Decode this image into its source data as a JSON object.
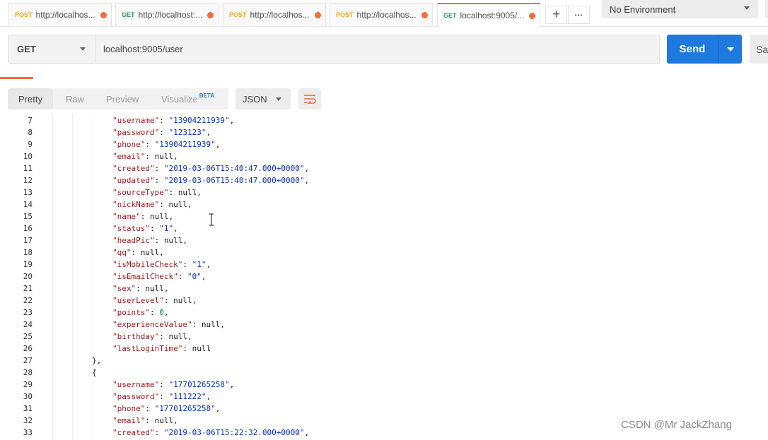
{
  "tabs": [
    {
      "method": "POST",
      "url": "http://localhos..."
    },
    {
      "method": "GET",
      "url": "http://localhost:..."
    },
    {
      "method": "POST",
      "url": "http://localhos..."
    },
    {
      "method": "POST",
      "url": "http://localhos..."
    },
    {
      "method": "GET",
      "url": "localhost:9005/..."
    }
  ],
  "tab_actions": {
    "new_tab": "+",
    "more": "•••"
  },
  "environment": {
    "selected": "No Environment"
  },
  "request": {
    "method": "GET",
    "url": "localhost:9005/user",
    "send_label": "Send",
    "save_label": "Sa"
  },
  "response_toolbar": {
    "views": [
      "Pretty",
      "Raw",
      "Preview",
      "Visualize"
    ],
    "visualize_badge": "BETA",
    "format": "JSON"
  },
  "code_lines": [
    {
      "n": "7",
      "indent": 3,
      "key": "username",
      "val": "\"13904211939\"",
      "type": "s",
      "comma": true
    },
    {
      "n": "8",
      "indent": 3,
      "key": "password",
      "val": "\"123123\"",
      "type": "s",
      "comma": true
    },
    {
      "n": "9",
      "indent": 3,
      "key": "phone",
      "val": "\"13904211939\"",
      "type": "s",
      "comma": true
    },
    {
      "n": "10",
      "indent": 3,
      "key": "email",
      "val": "null",
      "type": "p",
      "comma": true
    },
    {
      "n": "11",
      "indent": 3,
      "key": "created",
      "val": "\"2019-03-06T15:40:47.000+0000\"",
      "type": "s",
      "comma": true
    },
    {
      "n": "12",
      "indent": 3,
      "key": "updated",
      "val": "\"2019-03-06T15:40:47.000+0000\"",
      "type": "s",
      "comma": true
    },
    {
      "n": "13",
      "indent": 3,
      "key": "sourceType",
      "val": "null",
      "type": "p",
      "comma": true
    },
    {
      "n": "14",
      "indent": 3,
      "key": "nickName",
      "val": "null",
      "type": "p",
      "comma": true
    },
    {
      "n": "15",
      "indent": 3,
      "key": "name",
      "val": "null",
      "type": "p",
      "comma": true
    },
    {
      "n": "16",
      "indent": 3,
      "key": "status",
      "val": "\"1\"",
      "type": "s",
      "comma": true
    },
    {
      "n": "17",
      "indent": 3,
      "key": "headPic",
      "val": "null",
      "type": "p",
      "comma": true
    },
    {
      "n": "18",
      "indent": 3,
      "key": "qq",
      "val": "null",
      "type": "p",
      "comma": true
    },
    {
      "n": "19",
      "indent": 3,
      "key": "isMobileCheck",
      "val": "\"1\"",
      "type": "s",
      "comma": true
    },
    {
      "n": "20",
      "indent": 3,
      "key": "isEmailCheck",
      "val": "\"0\"",
      "type": "s",
      "comma": true
    },
    {
      "n": "21",
      "indent": 3,
      "key": "sex",
      "val": "null",
      "type": "p",
      "comma": true
    },
    {
      "n": "22",
      "indent": 3,
      "key": "userLevel",
      "val": "null",
      "type": "p",
      "comma": true
    },
    {
      "n": "23",
      "indent": 3,
      "key": "points",
      "val": "0",
      "type": "n",
      "comma": true
    },
    {
      "n": "24",
      "indent": 3,
      "key": "experienceValue",
      "val": "null",
      "type": "p",
      "comma": true
    },
    {
      "n": "25",
      "indent": 3,
      "key": "birthday",
      "val": "null",
      "type": "p",
      "comma": true
    },
    {
      "n": "26",
      "indent": 3,
      "key": "lastLoginTime",
      "val": "null",
      "type": "p",
      "comma": false
    },
    {
      "n": "27",
      "indent": 2,
      "raw": "},"
    },
    {
      "n": "28",
      "indent": 2,
      "raw": "{"
    },
    {
      "n": "29",
      "indent": 3,
      "key": "username",
      "val": "\"17701265258\"",
      "type": "s",
      "comma": true
    },
    {
      "n": "30",
      "indent": 3,
      "key": "password",
      "val": "\"111222\"",
      "type": "s",
      "comma": true
    },
    {
      "n": "31",
      "indent": 3,
      "key": "phone",
      "val": "\"17701265258\"",
      "type": "s",
      "comma": true
    },
    {
      "n": "32",
      "indent": 3,
      "key": "email",
      "val": "null",
      "type": "p",
      "comma": true
    },
    {
      "n": "33",
      "indent": 3,
      "key": "created",
      "val": "\"2019-03-06T15:22:32.000+0000\"",
      "type": "s",
      "comma": true
    }
  ],
  "watermark": "CSDN @Mr JackZhang",
  "colors": {
    "accent": "#f26b3a",
    "send": "#1f7ae0",
    "json_key": "#a51a1a",
    "json_string": "#0b2fd1"
  }
}
